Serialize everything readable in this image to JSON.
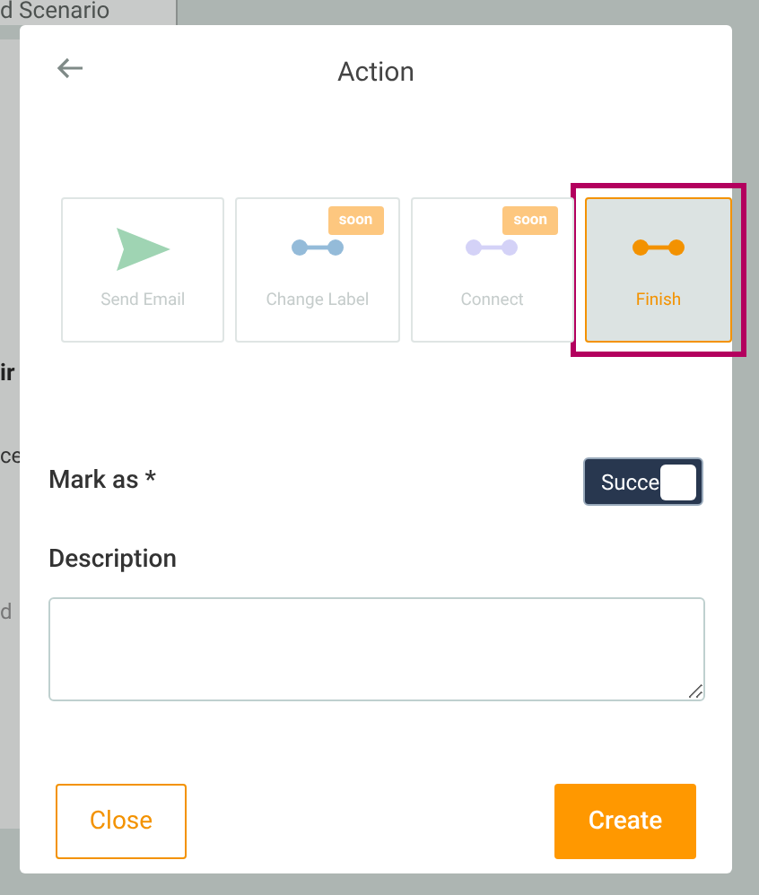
{
  "background": {
    "tab_label": "d Scenario",
    "heading_fragment": "ir",
    "text_fragment": "ce",
    "field_fragment": "d"
  },
  "dialog": {
    "title": "Action"
  },
  "actions": [
    {
      "label": "Send Email",
      "kind": "send",
      "color": "#9fd4b3",
      "selected": false
    },
    {
      "label": "Change Label",
      "kind": "connector",
      "color": "#94bbd9",
      "badge": "soon",
      "selected": false
    },
    {
      "label": "Connect",
      "kind": "connector",
      "color": "#d4d2f7",
      "badge": "soon",
      "selected": false
    },
    {
      "label": "Finish",
      "kind": "connector",
      "color": "#f39200",
      "selected": true
    }
  ],
  "mark_as": {
    "label": "Mark as *",
    "value": "Succe",
    "on": true
  },
  "description": {
    "label": "Description"
  },
  "buttons": [
    {
      "label": "Close",
      "kind": "outline"
    },
    {
      "label": "Create",
      "kind": "primary"
    }
  ]
}
